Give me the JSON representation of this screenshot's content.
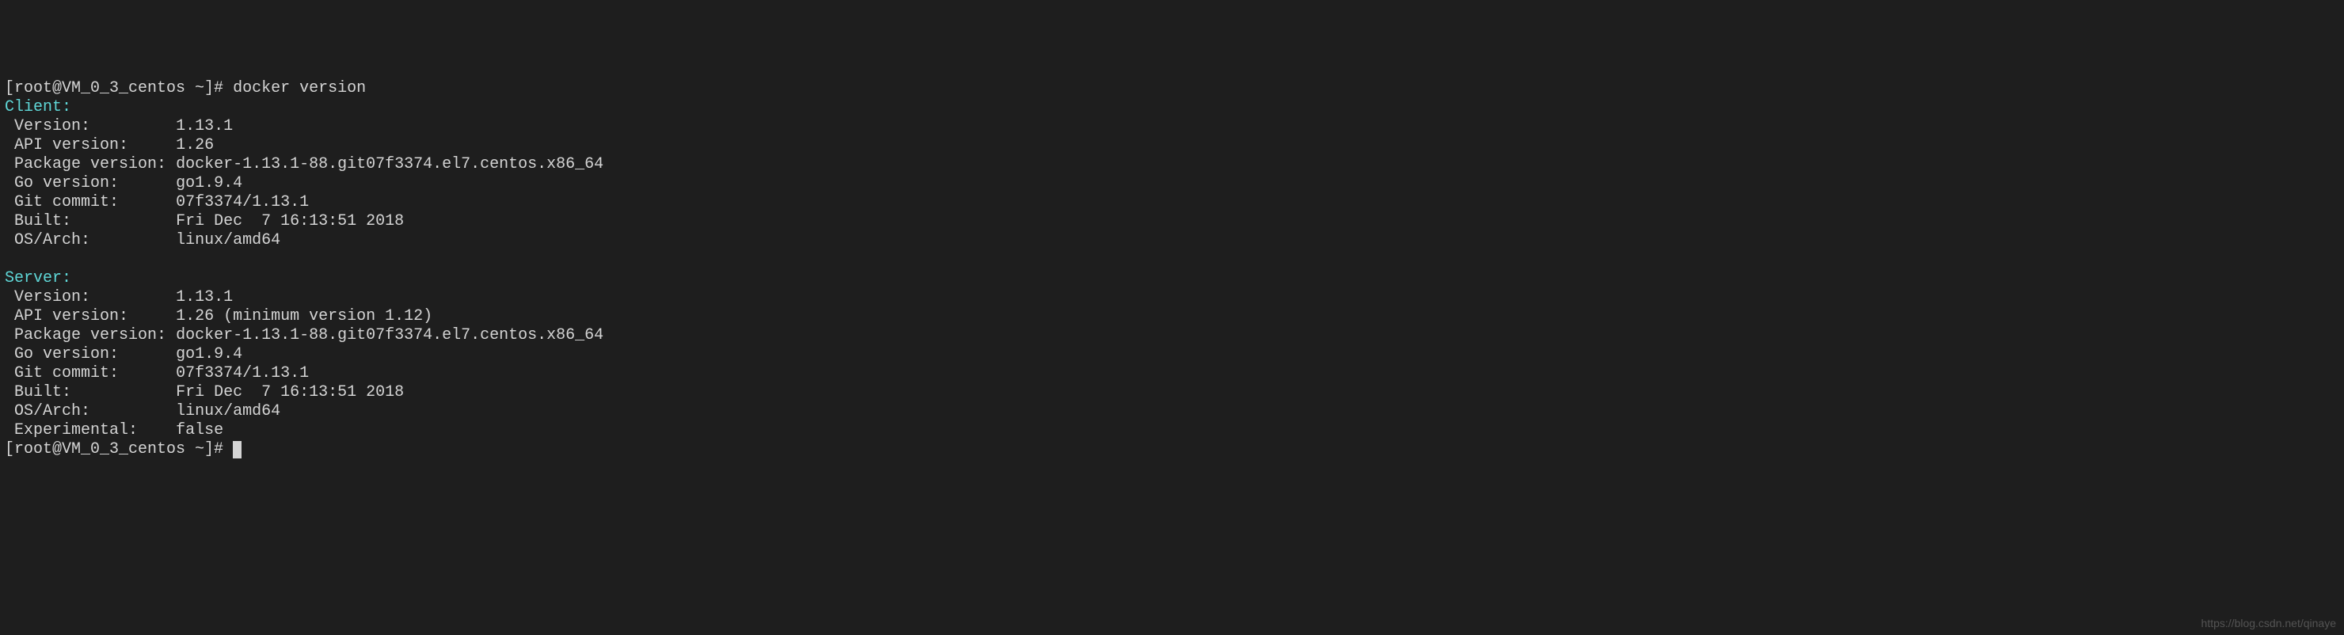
{
  "prompt1": {
    "user_host": "[root@VM_0_3_centos ~]#",
    "command": "docker version"
  },
  "client": {
    "header": "Client:",
    "rows": [
      {
        "label": " Version:        ",
        "value": "1.13.1"
      },
      {
        "label": " API version:    ",
        "value": "1.26"
      },
      {
        "label": " Package version:",
        "value": "docker-1.13.1-88.git07f3374.el7.centos.x86_64"
      },
      {
        "label": " Go version:     ",
        "value": "go1.9.4"
      },
      {
        "label": " Git commit:     ",
        "value": "07f3374/1.13.1"
      },
      {
        "label": " Built:          ",
        "value": "Fri Dec  7 16:13:51 2018"
      },
      {
        "label": " OS/Arch:        ",
        "value": "linux/amd64"
      }
    ]
  },
  "server": {
    "header": "Server:",
    "rows": [
      {
        "label": " Version:        ",
        "value": "1.13.1"
      },
      {
        "label": " API version:    ",
        "value": "1.26 (minimum version 1.12)"
      },
      {
        "label": " Package version:",
        "value": "docker-1.13.1-88.git07f3374.el7.centos.x86_64"
      },
      {
        "label": " Go version:     ",
        "value": "go1.9.4"
      },
      {
        "label": " Git commit:     ",
        "value": "07f3374/1.13.1"
      },
      {
        "label": " Built:          ",
        "value": "Fri Dec  7 16:13:51 2018"
      },
      {
        "label": " OS/Arch:        ",
        "value": "linux/amd64"
      },
      {
        "label": " Experimental:   ",
        "value": "false"
      }
    ]
  },
  "prompt2": {
    "user_host": "[root@VM_0_3_centos ~]#"
  },
  "watermark": "https://blog.csdn.net/qinaye"
}
